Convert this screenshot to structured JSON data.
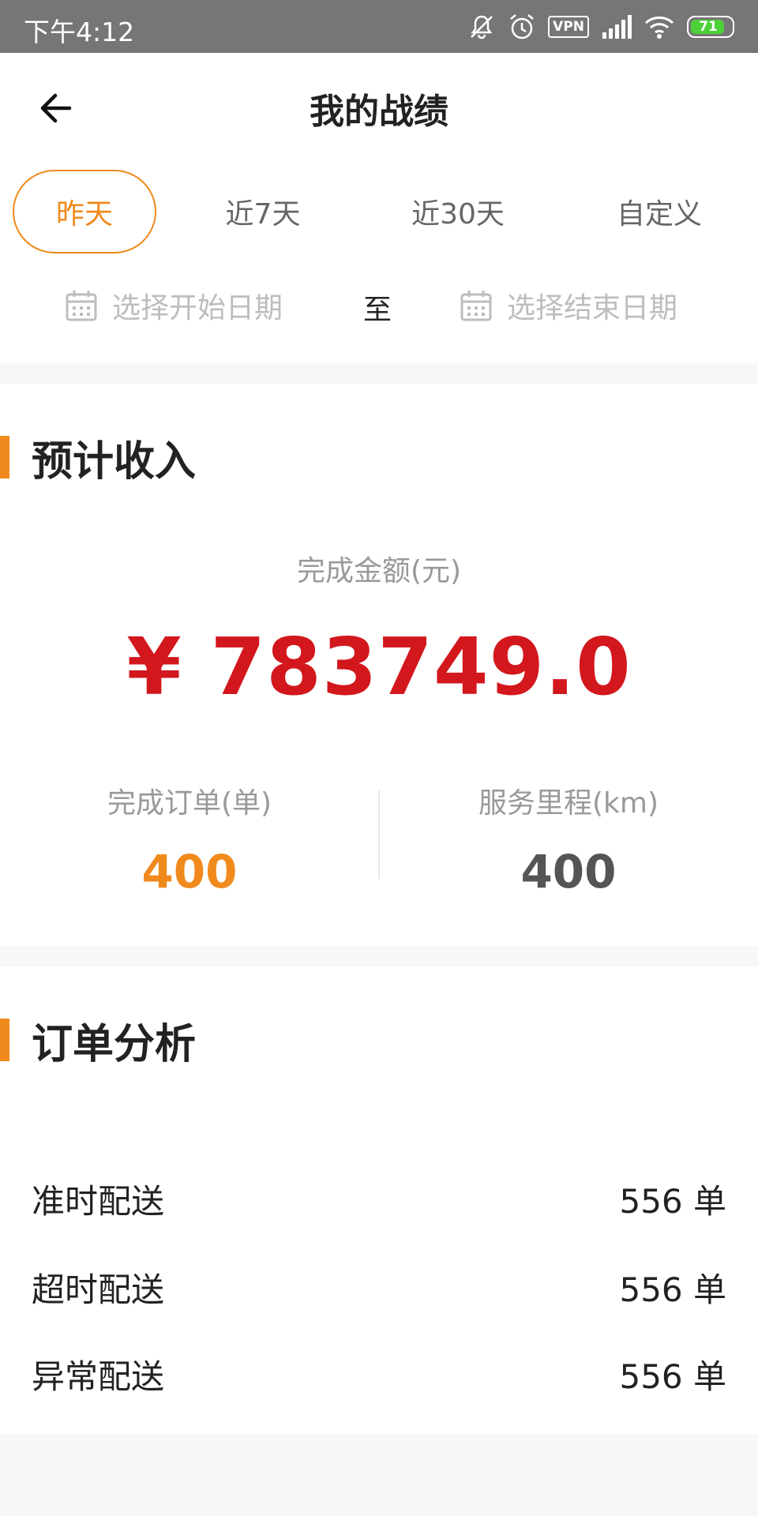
{
  "status_bar": {
    "time": "下午4:12",
    "vpn_label": "VPN",
    "battery_level": "71",
    "icons": [
      "mute-bell-icon",
      "alarm-icon",
      "vpn-icon",
      "signal-icon",
      "wifi-icon",
      "battery-icon"
    ]
  },
  "header": {
    "title": "我的战绩",
    "back_icon": "back-arrow-icon"
  },
  "tabs": [
    {
      "label": "昨天",
      "active": true
    },
    {
      "label": "近7天",
      "active": false
    },
    {
      "label": "近30天",
      "active": false
    },
    {
      "label": "自定义",
      "active": false
    }
  ],
  "date_range": {
    "start_placeholder": "选择开始日期",
    "separator": "至",
    "end_placeholder": "选择结束日期",
    "icon": "calendar-icon"
  },
  "income": {
    "section_title": "预计收入",
    "amount_label": "完成金额(元)",
    "amount_value": "¥ 783749.0",
    "orders_label": "完成订单(单)",
    "orders_value": "400",
    "mileage_label": "服务里程(km)",
    "mileage_value": "400"
  },
  "order_analysis": {
    "section_title": "订单分析",
    "rows": [
      {
        "label": "准时配送",
        "value": "556 单"
      },
      {
        "label": "超时配送",
        "value": "556 单"
      },
      {
        "label": "异常配送",
        "value": "556 单"
      }
    ]
  },
  "colors": {
    "accent": "#f08a1c",
    "amount_red": "#d2171d",
    "status_bar": "#767676",
    "battery_green": "#4cd137"
  }
}
